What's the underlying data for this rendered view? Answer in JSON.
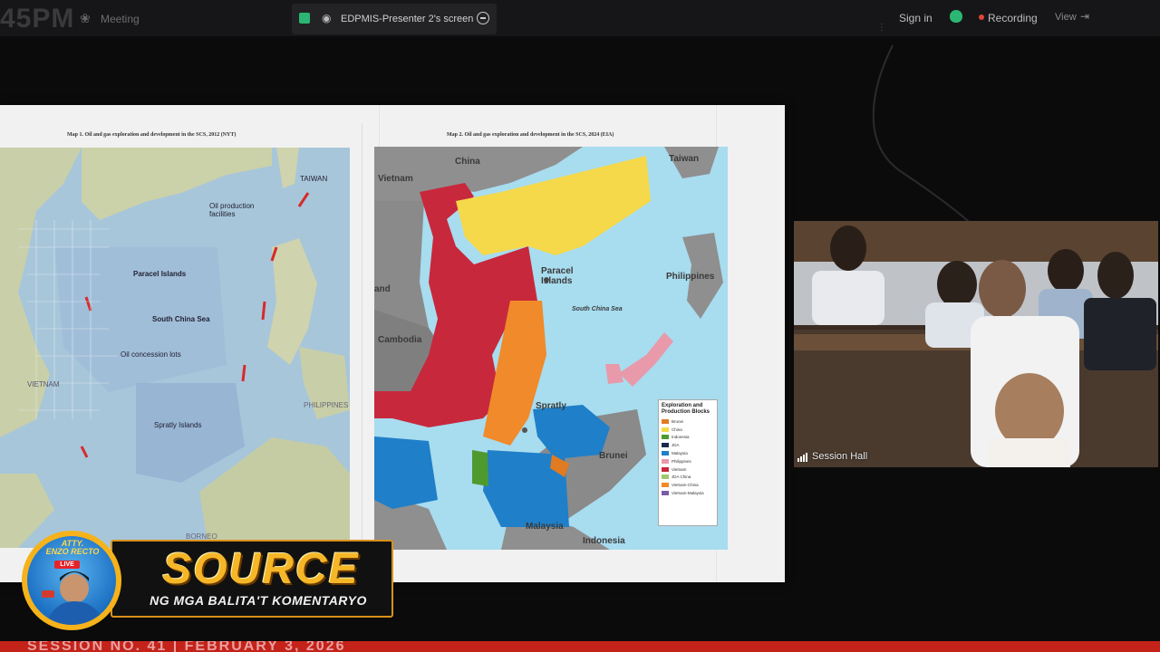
{
  "window": {
    "clock_text": "45PM",
    "meeting_label": "Meeting",
    "share_label": "EDPMIS-Presenter 2's screen",
    "sign_in_label": "Sign in",
    "recording_label": "Recording",
    "view_label": "View"
  },
  "slide": {
    "map1": {
      "caption": "Map 1. Oil and gas exploration and development in the SCS, 2012 (NYT)",
      "labels": {
        "taiwan": "TAIWAN",
        "oil_production": "Oil production facilities",
        "paracel": "Paracel Islands",
        "scs": "South China Sea",
        "concession": "Oil concession lots",
        "vietnam": "VIETNAM",
        "spratly": "Spratly Islands",
        "philippines": "PHILIPPINES",
        "borneo": "BORNEO"
      }
    },
    "map2": {
      "caption": "Map 2. Oil and gas exploration and development in the SCS, 2024 (EIA)",
      "labels": {
        "china": "China",
        "taiwan": "Taiwan",
        "vietnam": "Vietnam",
        "paracel": "Paracel Islands",
        "philippines": "Philippines",
        "scs": "South China Sea",
        "land": "and",
        "cambodia": "Cambodia",
        "spratly": "Spratly",
        "brunei": "Brunei",
        "malaysia": "Malaysia",
        "indonesia": "Indonesia"
      },
      "legend": {
        "title": "Exploration and Production Blocks",
        "items": [
          {
            "label": "Brunei",
            "color": "#e07b22"
          },
          {
            "label": "China",
            "color": "#f5d94a"
          },
          {
            "label": "Indonesia",
            "color": "#4e9a2f"
          },
          {
            "label": "JDA",
            "color": "#1a2a4a"
          },
          {
            "label": "Malaysia",
            "color": "#1f7fc8"
          },
          {
            "label": "Philippines",
            "color": "#e89aaa"
          },
          {
            "label": "Vietnam",
            "color": "#c8283c"
          },
          {
            "label": "JDA China",
            "color": "#a0c870"
          },
          {
            "label": "Vietnam-China",
            "color": "#f08a2a"
          },
          {
            "label": "Vietnam-Malaysia",
            "color": "#7a5aa8"
          }
        ]
      }
    }
  },
  "camera": {
    "label": "Session Hall"
  },
  "branding": {
    "name_line1": "ATTY.",
    "name_line2": "ENZO RECTO",
    "live": "LIVE",
    "title": "SOURCE",
    "subtitle": "NG MGA BALITA'T KOMENTARYO"
  },
  "ticker": "SESSION NO. 41 | FEBRUARY 3, 2026"
}
